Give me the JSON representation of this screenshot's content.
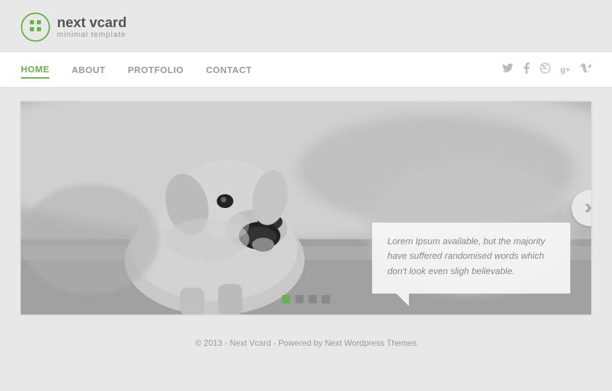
{
  "logo": {
    "icon": "⊞",
    "title": "next vcard",
    "subtitle": "minimal template"
  },
  "nav": {
    "links": [
      {
        "label": "HOME",
        "active": true
      },
      {
        "label": "ABOUT",
        "active": false
      },
      {
        "label": "PROTFOLIO",
        "active": false
      },
      {
        "label": "CONTACT",
        "active": false
      }
    ],
    "social": [
      {
        "name": "twitter",
        "icon": "𝕥"
      },
      {
        "name": "facebook",
        "icon": "f"
      },
      {
        "name": "dribbble",
        "icon": "⊛"
      },
      {
        "name": "googleplus",
        "icon": "g⁺"
      },
      {
        "name": "vimeo",
        "icon": "v"
      }
    ]
  },
  "slider": {
    "caption": "Lorem Ipsum available, but the majority have suffered randomised words which don't look even sligh believable.",
    "dots": [
      {
        "active": true
      },
      {
        "active": false
      },
      {
        "active": false
      },
      {
        "active": false
      }
    ],
    "arrow_label": "◀▶"
  },
  "footer": {
    "text": "© 2013 - Next Vcard - Powered by Next Wordpress Themes"
  }
}
